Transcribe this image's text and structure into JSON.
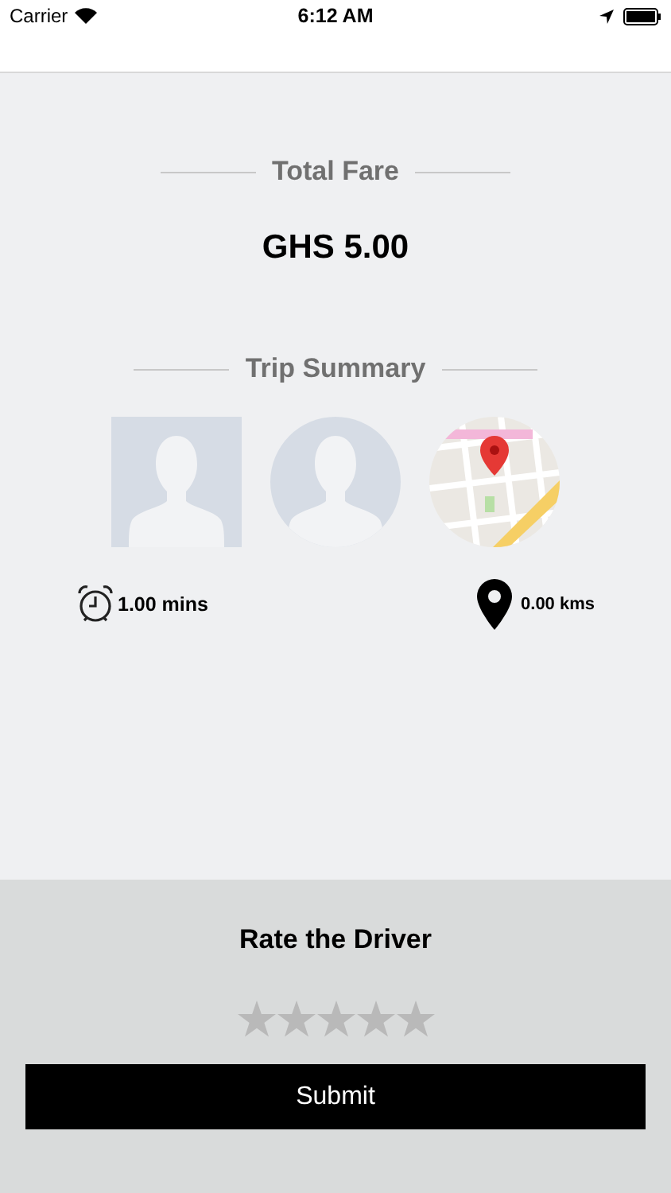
{
  "status_bar": {
    "carrier": "Carrier",
    "time": "6:12 AM"
  },
  "fare": {
    "heading": "Total Fare",
    "amount": "GHS 5.00"
  },
  "trip": {
    "heading": "Trip Summary",
    "duration": "1.00 mins",
    "distance": "0.00 kms"
  },
  "rating": {
    "title": "Rate the Driver",
    "stars": 0
  },
  "submit": "Submit"
}
